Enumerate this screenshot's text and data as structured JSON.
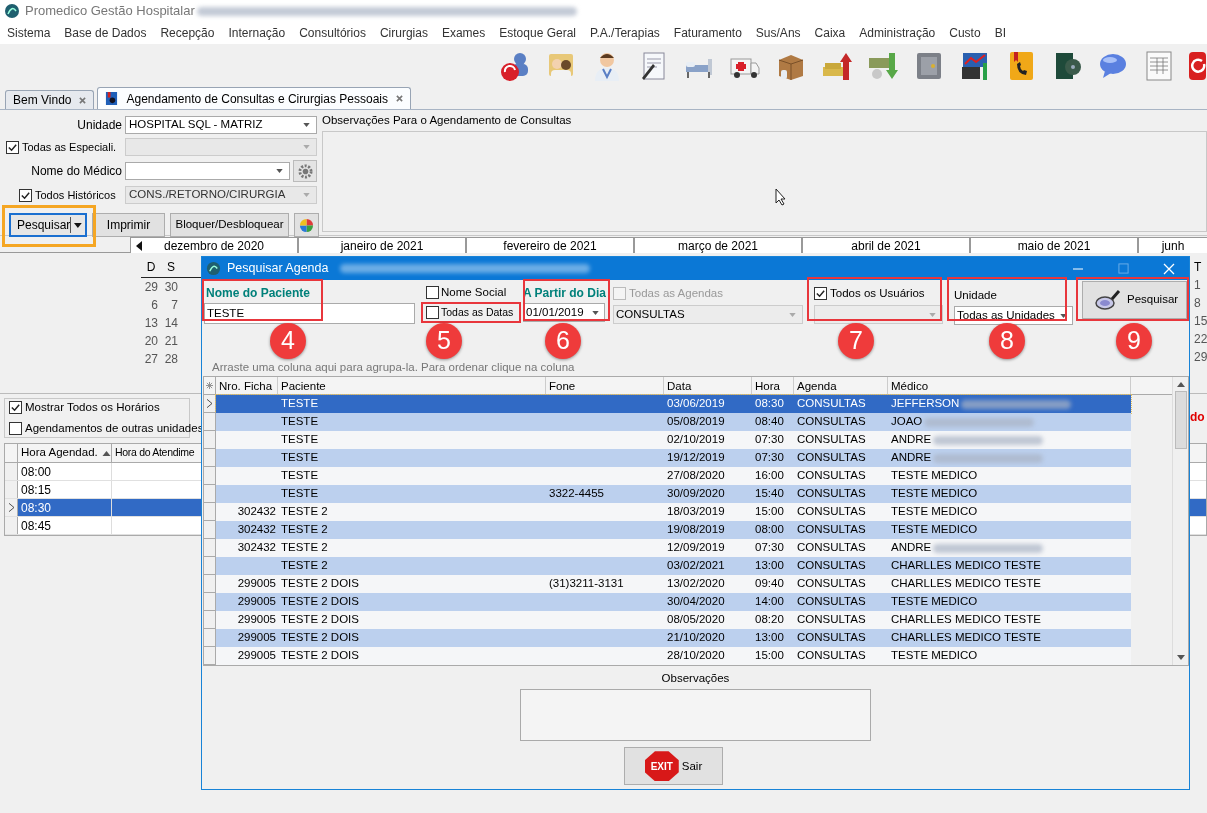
{
  "app": {
    "title": "Promedico Gestão Hospitalar",
    "title_redacted": true
  },
  "menu": [
    "Sistema",
    "Base de Dados",
    "Recepção",
    "Internação",
    "Consultórios",
    "Cirurgias",
    "Exames",
    "Estoque Geral",
    "P.A./Terapias",
    "Faturamento",
    "Sus/Ans",
    "Caixa",
    "Administração",
    "Custo",
    "BI"
  ],
  "tabs": [
    {
      "label": "Bem Vindo",
      "selected": false
    },
    {
      "label": "Agendamento de Consultas e Cirurgias Pessoais",
      "selected": true
    }
  ],
  "form": {
    "unidade_label": "Unidade",
    "unidade_value": "HOSPITAL SQL - MATRIZ",
    "especialidades": {
      "label": "Todas as Especiali.",
      "checked": true
    },
    "medico_label": "Nome do Médico",
    "historicos": {
      "label": "Todos Históricos",
      "checked": true,
      "value": "CONS./RETORNO/CIRURGIA"
    },
    "buttons": [
      "Pesquisar",
      "Imprimir",
      "Bloquer/Desbloquear"
    ],
    "observacoes_label": "Observações Para o Agendamento de Consultas"
  },
  "calendar": {
    "months": [
      "dezembro de 2020",
      "janeiro de 2021",
      "fevereiro de 2021",
      "março de 2021",
      "abril de 2021",
      "maio de 2021",
      "junh"
    ],
    "weekdays": [
      "D",
      "S"
    ],
    "weeks": [
      [
        "29",
        "30"
      ],
      [
        "6",
        "7"
      ],
      [
        "13",
        "14"
      ],
      [
        "20",
        "21"
      ],
      [
        "27",
        "28"
      ]
    ],
    "right_weekday": "T",
    "right_days": [
      "1",
      "8",
      "15",
      "22",
      "29"
    ]
  },
  "red_note": "do",
  "options": [
    {
      "label": "Mostrar Todos os Horários",
      "checked": true
    },
    {
      "label": "Agendamentos de outras unidades",
      "checked": false
    }
  ],
  "schedule": {
    "columns": [
      "Hora Agendad.",
      "Hora do Atendime"
    ],
    "rows": [
      {
        "time": "08:00",
        "selected": false
      },
      {
        "time": "08:15",
        "selected": false
      },
      {
        "time": "08:30",
        "selected": true
      },
      {
        "time": "08:45",
        "selected": false
      }
    ]
  },
  "dialog": {
    "title": "Pesquisar Agenda",
    "title_redacted": true,
    "patient": {
      "label": "Nome do Paciente",
      "value": "TESTE"
    },
    "nome_social": {
      "label": "Nome Social",
      "checked": false
    },
    "todas_datas": {
      "label": "Todas as Datas",
      "checked": false
    },
    "date": {
      "label": "A Partir do Dia",
      "value": "01/01/2019"
    },
    "todas_agendas": {
      "label": "Todas as Agendas",
      "checked": false,
      "disabled": true
    },
    "agenda_value": "CONSULTAS",
    "todos_usuarios": {
      "label": "Todos os Usuários",
      "checked": true
    },
    "unidade": {
      "label": "Unidade",
      "value": "Todas as Unidades"
    },
    "search_button": "Pesquisar",
    "group_hint": "Arraste uma coluna aqui para agrupa-la. Para ordenar clique na coluna",
    "columns": [
      "Nro. Ficha",
      "Paciente",
      "Fone",
      "Data",
      "Hora",
      "Agenda",
      "Médico"
    ],
    "rows": [
      {
        "ficha": "",
        "paciente": "TESTE",
        "fone": "",
        "data": "03/06/2019",
        "hora": "08:30",
        "agenda": "CONSULTAS",
        "medico": "JEFFERSON",
        "redacted": true,
        "selected": true
      },
      {
        "ficha": "",
        "paciente": "TESTE",
        "fone": "",
        "data": "05/08/2019",
        "hora": "08:40",
        "agenda": "CONSULTAS",
        "medico": "JOAO",
        "redacted": true,
        "selected": false
      },
      {
        "ficha": "",
        "paciente": "TESTE",
        "fone": "",
        "data": "02/10/2019",
        "hora": "07:30",
        "agenda": "CONSULTAS",
        "medico": "ANDRE",
        "redacted": true,
        "selected": false
      },
      {
        "ficha": "",
        "paciente": "TESTE",
        "fone": "",
        "data": "19/12/2019",
        "hora": "07:30",
        "agenda": "CONSULTAS",
        "medico": "ANDRE",
        "redacted": true,
        "selected": false
      },
      {
        "ficha": "",
        "paciente": "TESTE",
        "fone": "",
        "data": "27/08/2020",
        "hora": "16:00",
        "agenda": "CONSULTAS",
        "medico": "TESTE MEDICO",
        "redacted": false,
        "selected": false
      },
      {
        "ficha": "",
        "paciente": "TESTE",
        "fone": "3322-4455",
        "data": "30/09/2020",
        "hora": "15:40",
        "agenda": "CONSULTAS",
        "medico": "TESTE MEDICO",
        "redacted": false,
        "selected": false
      },
      {
        "ficha": "302432",
        "paciente": "TESTE 2",
        "fone": "",
        "data": "18/03/2019",
        "hora": "15:00",
        "agenda": "CONSULTAS",
        "medico": "TESTE MEDICO",
        "redacted": false,
        "selected": false
      },
      {
        "ficha": "302432",
        "paciente": "TESTE 2",
        "fone": "",
        "data": "19/08/2019",
        "hora": "08:00",
        "agenda": "CONSULTAS",
        "medico": "TESTE MEDICO",
        "redacted": false,
        "selected": false
      },
      {
        "ficha": "302432",
        "paciente": "TESTE 2",
        "fone": "",
        "data": "12/09/2019",
        "hora": "07:30",
        "agenda": "CONSULTAS",
        "medico": "ANDRE",
        "redacted": true,
        "selected": false
      },
      {
        "ficha": "",
        "paciente": "TESTE 2",
        "fone": "",
        "data": "03/02/2021",
        "hora": "13:00",
        "agenda": "CONSULTAS",
        "medico": "CHARLLES MEDICO TESTE",
        "redacted": false,
        "selected": false
      },
      {
        "ficha": "299005",
        "paciente": "TESTE 2 DOIS",
        "fone": "(31)3211-3131",
        "data": "13/02/2020",
        "hora": "09:40",
        "agenda": "CONSULTAS",
        "medico": "CHARLLES MEDICO TESTE",
        "redacted": false,
        "selected": false
      },
      {
        "ficha": "299005",
        "paciente": "TESTE 2 DOIS",
        "fone": "",
        "data": "30/04/2020",
        "hora": "14:00",
        "agenda": "CONSULTAS",
        "medico": "TESTE MEDICO",
        "redacted": false,
        "selected": false
      },
      {
        "ficha": "299005",
        "paciente": "TESTE 2 DOIS",
        "fone": "",
        "data": "08/05/2020",
        "hora": "08:20",
        "agenda": "CONSULTAS",
        "medico": "CHARLLES MEDICO TESTE",
        "redacted": false,
        "selected": false
      },
      {
        "ficha": "299005",
        "paciente": "TESTE 2 DOIS",
        "fone": "",
        "data": "21/10/2020",
        "hora": "13:00",
        "agenda": "CONSULTAS",
        "medico": "CHARLLES MEDICO TESTE",
        "redacted": false,
        "selected": false
      },
      {
        "ficha": "299005",
        "paciente": "TESTE 2 DOIS",
        "fone": "",
        "data": "28/10/2020",
        "hora": "15:00",
        "agenda": "CONSULTAS",
        "medico": "TESTE MEDICO",
        "redacted": false,
        "selected": false
      }
    ],
    "observacoes_label": "Observações",
    "exit_sign": "EXIT",
    "exit_button": "Sair"
  },
  "annotations": [
    "4",
    "5",
    "6",
    "7",
    "8",
    "9"
  ]
}
